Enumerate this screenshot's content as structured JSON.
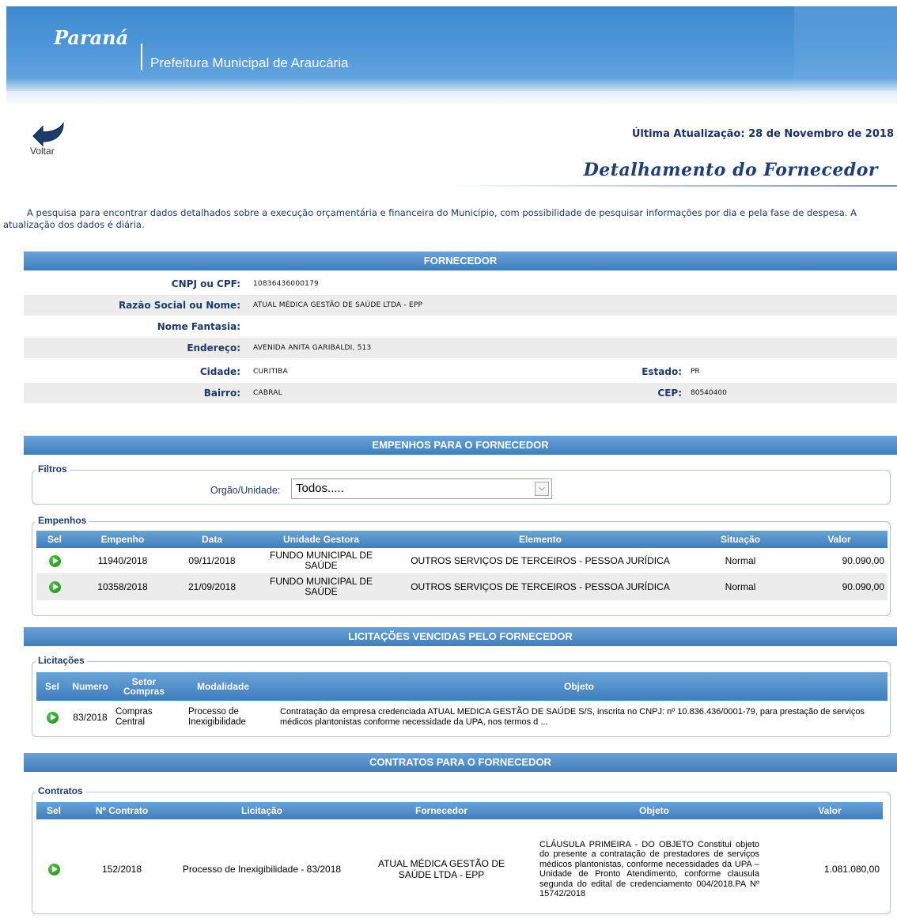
{
  "header": {
    "brand": "Paraná",
    "subtitle": "Prefeitura Municipal de Araucária"
  },
  "nav": {
    "back_label": "Voltar"
  },
  "last_update": "Última Atualização: 28 de Novembro de 2018",
  "page_title": "Detalhamento do Fornecedor",
  "intro": "A pesquisa para encontrar dados detalhados sobre a execução orçamentária e financeira do Município, com possibilidade de pesquisar informações por dia e pela fase de despesa. A atualização dos dados é diária.",
  "fornecedor": {
    "section_title": "FORNECEDOR",
    "cnpj_label": "CNPJ ou CPF:",
    "cnpj": "10836436000179",
    "razao_label": "Razão Social ou Nome:",
    "razao": "ATUAL MÉDICA GESTÃO DE SAÚDE LTDA - EPP",
    "fantasia_label": "Nome Fantasia:",
    "fantasia": "",
    "endereco_label": "Endereço:",
    "endereco": "AVENIDA ANITA GARIBALDI, 513",
    "cidade_label": "Cidade:",
    "cidade": "CURITIBA",
    "estado_label": "Estado:",
    "estado": "PR",
    "bairro_label": "Bairro:",
    "bairro": "CABRAL",
    "cep_label": "CEP:",
    "cep": "80540400"
  },
  "empenhos": {
    "section_title": "EMPENHOS PARA O FORNECEDOR",
    "filters_legend": "Filtros",
    "filter_label": "Orgão/Unidade:",
    "filter_value": "Todos.....",
    "table_legend": "Empenhos",
    "columns": [
      "Sel",
      "Empenho",
      "Data",
      "Unidade Gestora",
      "Elemento",
      "Situação",
      "Valor"
    ],
    "rows": [
      {
        "empenho": "11940/2018",
        "data": "09/11/2018",
        "unidade": "FUNDO MUNICIPAL DE SAÚDE",
        "elemento": "OUTROS SERVIÇOS DE TERCEIROS - PESSOA JURÍDICA",
        "situacao": "Normal",
        "valor": "90.090,00"
      },
      {
        "empenho": "10358/2018",
        "data": "21/09/2018",
        "unidade": "FUNDO MUNICIPAL DE SAÚDE",
        "elemento": "OUTROS SERVIÇOS DE TERCEIROS - PESSOA JURÍDICA",
        "situacao": "Normal",
        "valor": "90.090,00"
      }
    ]
  },
  "licitacoes": {
    "section_title": "LICITAÇÕES VENCIDAS PELO FORNECEDOR",
    "table_legend": "Licitações",
    "columns": [
      "Sel",
      "Numero",
      "Setor Compras",
      "Modalidade",
      "Objeto"
    ],
    "rows": [
      {
        "numero": "83/2018",
        "setor": "Compras Central",
        "modalidade": "Processo de Inexigibilidade",
        "objeto": "Contratação da empresa credenciada ATUAL MEDICA GESTÃO DE SAÚDE S/S, inscrita no CNPJ: nº 10.836.436/0001-79, para prestação de serviços médicos plantonistas conforme necessidade da UPA, nos termos d ..."
      }
    ]
  },
  "contratos": {
    "section_title": "CONTRATOS PARA O FORNECEDOR",
    "table_legend": "Contratos",
    "columns": [
      "Sel",
      "Nº Contrato",
      "Licitação",
      "Fornecedor",
      "Objeto",
      "Valor"
    ],
    "rows": [
      {
        "contrato": "152/2018",
        "licitacao": "Processo de Inexigibilidade - 83/2018",
        "fornecedor": "ATUAL MÉDICA GESTÃO DE SAÚDE LTDA - EPP",
        "objeto": "CLÁUSULA PRIMEIRA - DO OBJETO Constitui objeto do presente a contratação de prestadores de serviços médicos plantonistas, conforme necessidades da UPA – Unidade de Pronto Atendimento, conforme clausula segunda do edital de credenciamento 004/2018.PA Nº 15742/2018",
        "valor": "1.081.080,00"
      }
    ]
  }
}
